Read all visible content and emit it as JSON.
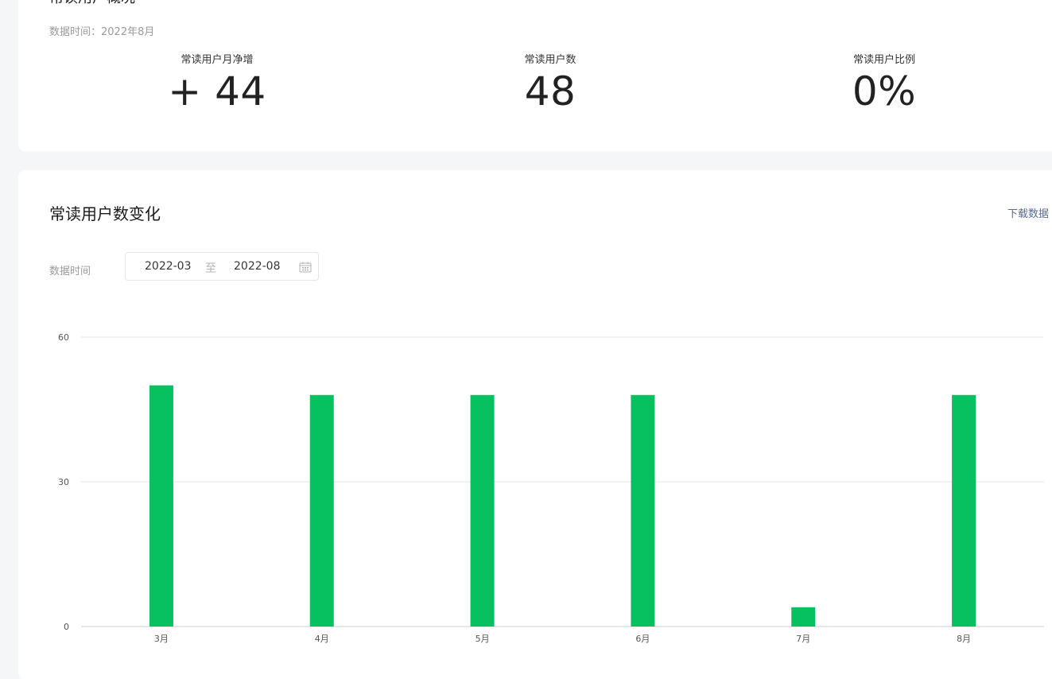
{
  "overview": {
    "title": "常读用户概况",
    "data_time": "数据时间：2022年8月",
    "stats": [
      {
        "label": "常读用户月净增",
        "value": "+ 44"
      },
      {
        "label": "常读用户数",
        "value": "48"
      },
      {
        "label": "常读用户比例",
        "value": "0%"
      }
    ]
  },
  "trend": {
    "title": "常读用户数变化",
    "download_label": "下载数据",
    "filter_label": "数据时间",
    "date_start": "2022-03",
    "date_separator": "至",
    "date_end": "2022-08"
  },
  "colors": {
    "bar": "#07c160",
    "grid": "#e5e5e5",
    "link": "#576b95"
  },
  "chart_data": {
    "type": "bar",
    "categories": [
      "3月",
      "4月",
      "5月",
      "6月",
      "7月",
      "8月"
    ],
    "values": [
      50,
      48,
      48,
      48,
      4,
      48
    ],
    "title": "",
    "xlabel": "",
    "ylabel": "",
    "ylim": [
      0,
      60
    ],
    "yticks": [
      0,
      30,
      60
    ],
    "grid": true
  }
}
